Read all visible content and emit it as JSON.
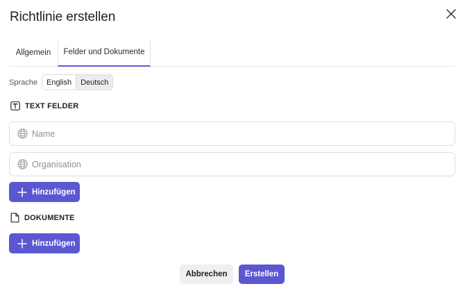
{
  "dialog": {
    "title": "Richtlinie erstellen",
    "close_icon": "close-icon"
  },
  "tabs": [
    {
      "label": "Allgemein",
      "active": false
    },
    {
      "label": "Felder und Dokumente",
      "active": true
    }
  ],
  "language": {
    "label": "Sprache",
    "options": [
      "English",
      "Deutsch"
    ],
    "selected": "Deutsch"
  },
  "text_fields": {
    "heading": "TEXT FELDER",
    "icon": "text-field-icon",
    "fields": [
      {
        "placeholder": "Name",
        "value": "",
        "icon": "globe-icon"
      },
      {
        "placeholder": "Organisation",
        "value": "",
        "icon": "globe-icon"
      }
    ],
    "add_label": "Hinzufügen"
  },
  "documents": {
    "heading": "DOKUMENTE",
    "icon": "document-icon",
    "add_label": "Hinzufügen"
  },
  "footer": {
    "cancel_label": "Abbrechen",
    "create_label": "Erstellen"
  },
  "colors": {
    "accent": "#5b57d1",
    "tab_underline": "#5b5bd6",
    "border": "#dedee4",
    "cancel_bg": "#efeff1"
  }
}
